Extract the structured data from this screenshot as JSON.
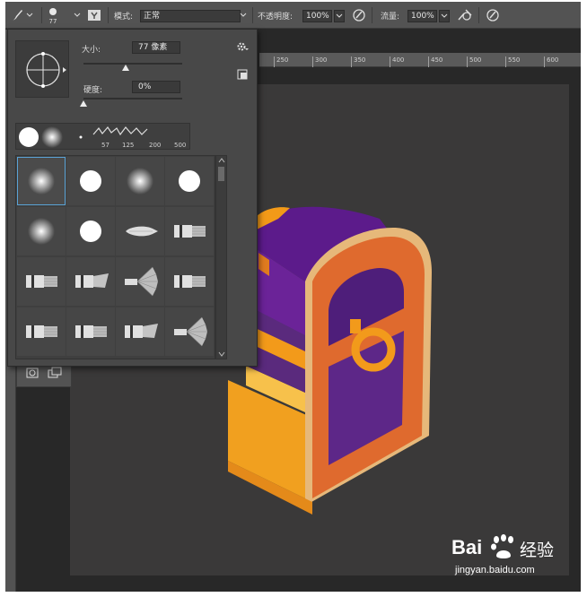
{
  "options_bar": {
    "brush_size_value": "77",
    "mode_label": "模式:",
    "mode_value": "正常",
    "opacity_label": "不透明度:",
    "opacity_value": "100%",
    "flow_label": "流量:",
    "flow_value": "100%"
  },
  "brush_picker": {
    "size_label": "大小:",
    "size_value": "77 像素",
    "size_slider_level": 0.43,
    "hardness_label": "硬度:",
    "hardness_value": "0%",
    "hardness_slider_level": 0.0,
    "recent_brushes": [
      "57",
      "125",
      "200",
      "500"
    ],
    "presets": [
      "soft-round",
      "hard-round",
      "soft-round",
      "hard-round",
      "soft-round",
      "hard-round",
      "brush-tip",
      "flat-brush",
      "flat-brush",
      "flat-angle-brush",
      "fan-brush",
      "flat-brush",
      "flat-brush",
      "flat-brush",
      "flat-angle-brush",
      "fan-brush"
    ]
  },
  "ruler_ticks": [
    "250",
    "300",
    "350",
    "400",
    "450",
    "500",
    "550",
    "600"
  ],
  "watermark": {
    "brand": "Bai",
    "brand2": "经验",
    "url": "jingyan.baidu.com"
  },
  "colors": {
    "ui_dark": "#535353",
    "panel": "#484848",
    "canvas": "#3a3939",
    "chest_purple": "#5e1b8c",
    "chest_orange": "#e0672a",
    "chest_gold": "#f5a31e",
    "selection": "#5aa3d6"
  }
}
